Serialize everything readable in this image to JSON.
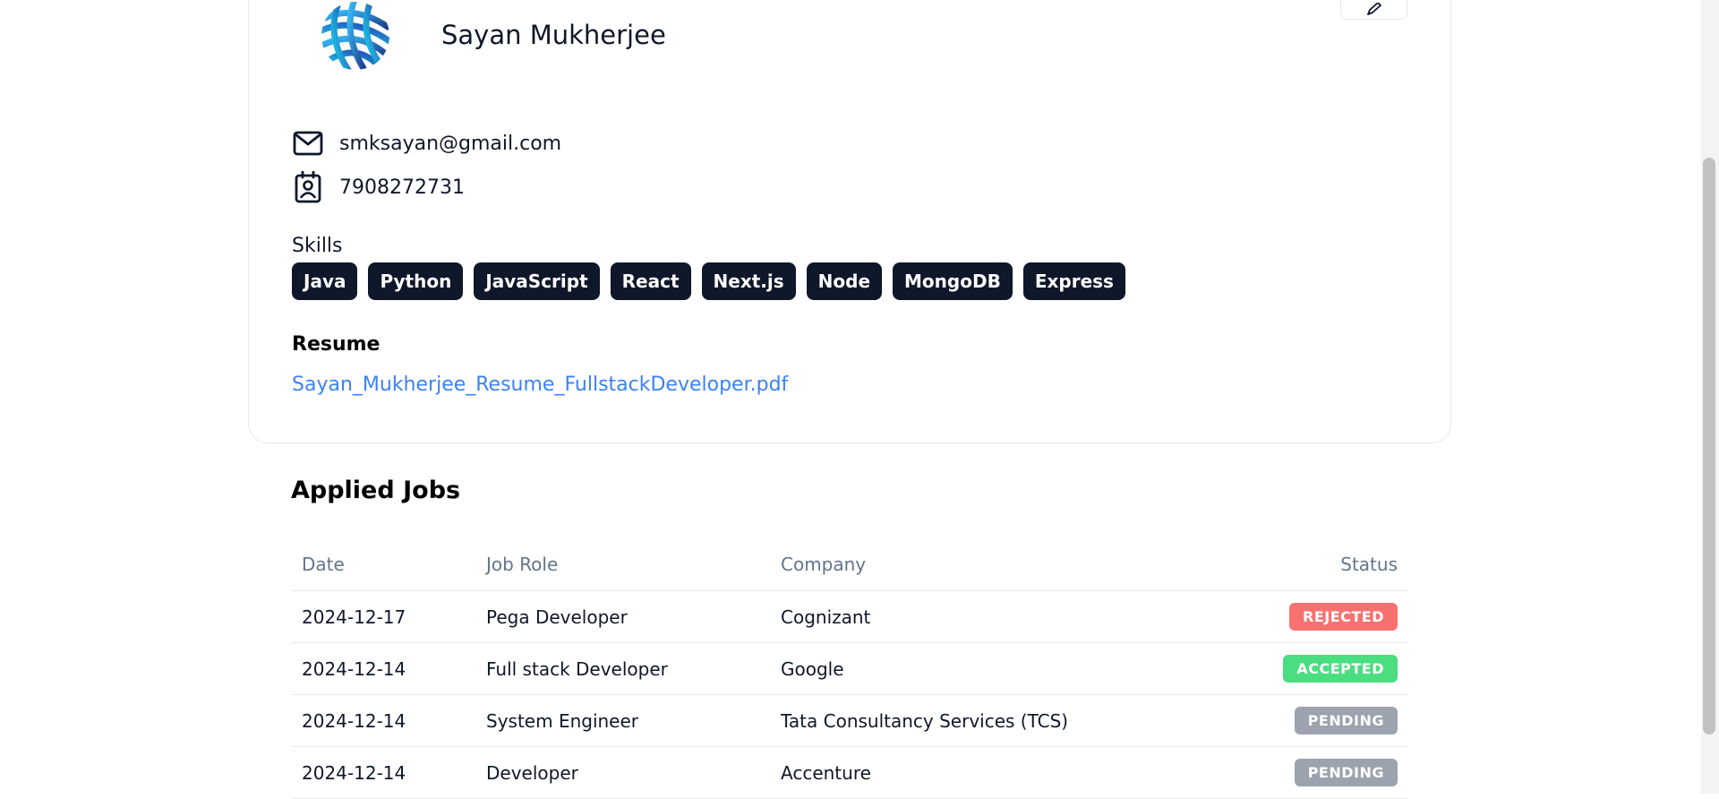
{
  "profile": {
    "name": "Sayan Mukherjee",
    "email": "smksayan@gmail.com",
    "phone": "7908272731",
    "skills_label": "Skills",
    "skills": [
      "Java",
      "Python",
      "JavaScript",
      "React",
      "Next.js",
      "Node",
      "MongoDB",
      "Express"
    ],
    "resume_label": "Resume",
    "resume_file": "Sayan_Mukherjee_Resume_FullstackDeveloper.pdf"
  },
  "icons": {
    "email": "mail-icon",
    "phone": "contact-icon",
    "edit": "pen-icon",
    "avatar": "logo-avatar"
  },
  "applied_jobs": {
    "title": "Applied Jobs",
    "columns": [
      "Date",
      "Job Role",
      "Company",
      "Status"
    ],
    "rows": [
      {
        "date": "2024-12-17",
        "role": "Pega Developer",
        "company": "Cognizant",
        "status": "REJECTED"
      },
      {
        "date": "2024-12-14",
        "role": "Full stack Developer",
        "company": "Google",
        "status": "ACCEPTED"
      },
      {
        "date": "2024-12-14",
        "role": "System Engineer",
        "company": "Tata Consultancy Services (TCS)",
        "status": "PENDING"
      },
      {
        "date": "2024-12-14",
        "role": "Developer",
        "company": "Accenture",
        "status": "PENDING"
      }
    ]
  },
  "colors": {
    "rejected": "#f87171",
    "accepted": "#4ade80",
    "pending": "#9ca3af",
    "link": "#3b82f6",
    "chip": "#0f172a"
  }
}
